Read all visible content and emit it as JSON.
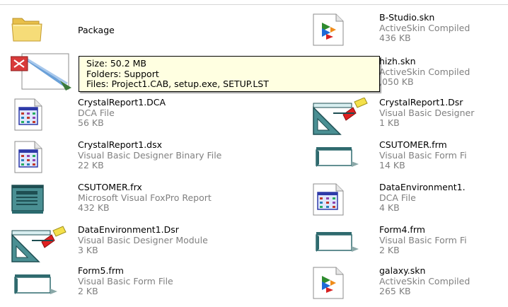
{
  "files_left": [
    {
      "name": "Package",
      "type": "",
      "size": "",
      "icon": "folder-icon"
    },
    {
      "name": "",
      "type": "",
      "size": "",
      "icon": "setup-list-icon"
    },
    {
      "name": "CrystalReport1.DCA",
      "type": "DCA File",
      "size": "56 KB",
      "icon": "dca-file-icon"
    },
    {
      "name": "CrystalReport1.dsx",
      "type": "Visual Basic Designer Binary File",
      "size": "22 KB",
      "icon": "dsx-file-icon"
    },
    {
      "name": "CSUTOMER.frx",
      "type": "Microsoft Visual FoxPro Report",
      "size": "432 KB",
      "icon": "foxpro-report-icon"
    },
    {
      "name": "DataEnvironment1.Dsr",
      "type": "Visual Basic Designer Module",
      "size": "3 KB",
      "icon": "vb-designer-icon"
    },
    {
      "name": "Form5.frm",
      "type": "Visual Basic Form File",
      "size": "2 KB",
      "icon": "vb-form-icon"
    }
  ],
  "files_right": [
    {
      "name": "B-Studio.skn",
      "type": "ActiveSkin Compiled",
      "size": "436 KB",
      "icon": "skin-file-icon"
    },
    {
      "name": "hizh.skn",
      "type": "ActiveSkin Compiled",
      "size": ",050 KB",
      "icon": "skin-file-icon"
    },
    {
      "name": "CrystalReport1.Dsr",
      "type": "Visual Basic Designer",
      "size": "1 KB",
      "icon": "vb-designer-icon"
    },
    {
      "name": "CSUTOMER.frm",
      "type": "Visual Basic Form Fi",
      "size": "14 KB",
      "icon": "vb-form-icon"
    },
    {
      "name": "DataEnvironment1.",
      "type": "DCA File",
      "size": "4 KB",
      "icon": "dca-file-icon"
    },
    {
      "name": "Form4.frm",
      "type": "Visual Basic Form Fi",
      "size": "2 KB",
      "icon": "vb-form-icon"
    },
    {
      "name": "galaxy.skn",
      "type": "ActiveSkin Compiled",
      "size": "265 KB",
      "icon": "skin-file-icon"
    }
  ],
  "tooltip": {
    "size_line": "Size: 50.2 MB",
    "folders_line": "Folders: Support",
    "files_line": "Files: Project1.CAB, setup.exe, SETUP.LST"
  },
  "colors": {
    "background": "#ffffff",
    "secondary_text": "#808080",
    "tooltip_background": "#ffffe1",
    "folder": "#f3d66a"
  }
}
